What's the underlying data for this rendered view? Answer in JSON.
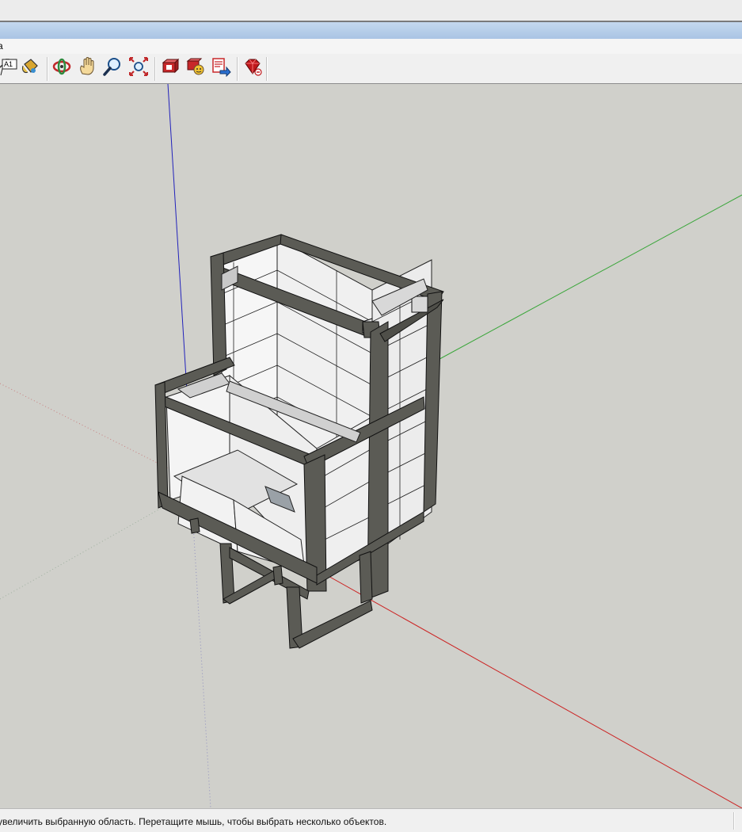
{
  "menubar": {
    "items": [
      "а"
    ]
  },
  "toolbar": {
    "groups": [
      {
        "name": "style-tools",
        "buttons": [
          {
            "id": "dimension",
            "icon": "dimension-arrow-icon"
          },
          {
            "id": "text",
            "icon": "text-label-icon",
            "label": "A1"
          },
          {
            "id": "paint",
            "icon": "paint-bucket-icon"
          }
        ]
      },
      {
        "name": "camera-tools",
        "buttons": [
          {
            "id": "orbit",
            "icon": "orbit-icon"
          },
          {
            "id": "pan",
            "icon": "pan-hand-icon"
          },
          {
            "id": "zoom",
            "icon": "zoom-magnifier-icon"
          },
          {
            "id": "zoom-extents",
            "icon": "zoom-extents-icon"
          }
        ]
      },
      {
        "name": "warehouse-tools",
        "buttons": [
          {
            "id": "get-models",
            "icon": "get-models-icon"
          },
          {
            "id": "share-model",
            "icon": "share-model-icon"
          },
          {
            "id": "share-component",
            "icon": "share-component-icon"
          }
        ]
      },
      {
        "name": "ruby-tools",
        "buttons": [
          {
            "id": "ruby-console",
            "icon": "ruby-gem-icon"
          }
        ]
      }
    ]
  },
  "colors": {
    "viewport_bg": "#d0d0cb",
    "axis_red": "#cc2222",
    "axis_green": "#3aa63a",
    "axis_blue": "#2222bb",
    "frame_steel": "#55554f",
    "brick_face": "#f4f4f4"
  },
  "status": {
    "text": "увеличить выбранную область. Перетащите мышь, чтобы выбрать несколько объектов."
  }
}
